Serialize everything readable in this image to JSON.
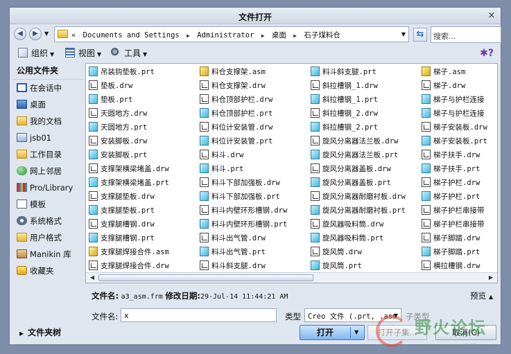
{
  "window": {
    "title": "文件打开",
    "close_glyph": "×"
  },
  "nav": {
    "back": "◀",
    "forward": "▶",
    "history_caret": "▼",
    "breadcrumbs": [
      "«",
      "Documents and Settings",
      "Administrator",
      "桌面",
      "石子煤料仓"
    ],
    "crumb_sep": "▶",
    "path_caret": "▼",
    "refresh_glyph": "⇆",
    "search_placeholder": "搜索..."
  },
  "toolbar": {
    "organize": "组织",
    "view": "视图",
    "tools": "工具",
    "caret": "▼",
    "help_glyph": "✱?"
  },
  "sidebar": {
    "heading": "公用文件夹",
    "items": [
      {
        "label": "在会话中",
        "icon": "session-icon"
      },
      {
        "label": "桌面",
        "icon": "desktop-icon"
      },
      {
        "label": "我的文档",
        "icon": "documents-folder-icon"
      },
      {
        "label": "jsb01",
        "icon": "computer-icon"
      },
      {
        "label": "工作目录",
        "icon": "working-dir-icon"
      },
      {
        "label": "网上邻居",
        "icon": "network-icon"
      },
      {
        "label": "Pro/Library",
        "icon": "library-icon"
      },
      {
        "label": "模板",
        "icon": "template-icon"
      },
      {
        "label": "系统格式",
        "icon": "system-format-icon"
      },
      {
        "label": "用户格式",
        "icon": "user-format-icon"
      },
      {
        "label": "Manikin 库",
        "icon": "manikin-icon"
      },
      {
        "label": "收藏夹",
        "icon": "favorites-icon"
      }
    ],
    "folder_tree": "文件夹树",
    "tree_caret": "▶"
  },
  "files": {
    "columns": [
      [
        {
          "name": "吊装钩垫板.prt",
          "type": "prt"
        },
        {
          "name": "垫板.drw",
          "type": "drw"
        },
        {
          "name": "垫板.prt",
          "type": "prt"
        },
        {
          "name": "天圆地方.drw",
          "type": "drw"
        },
        {
          "name": "天圆地方.prt",
          "type": "prt"
        },
        {
          "name": "安装脚板.drw",
          "type": "drw"
        },
        {
          "name": "安装脚板.prt",
          "type": "prt"
        },
        {
          "name": "支撑架横梁堵盖.drw",
          "type": "drw"
        },
        {
          "name": "支撑架横梁堵盖.prt",
          "type": "prt"
        },
        {
          "name": "支撑腿垫板.drw",
          "type": "drw"
        },
        {
          "name": "支撑腿垫板.prt",
          "type": "prt"
        },
        {
          "name": "支撑腿槽钢.drw",
          "type": "drw"
        },
        {
          "name": "支撑腿槽钢.prt",
          "type": "prt"
        },
        {
          "name": "支撑腿焊接合件.asm",
          "type": "asm"
        },
        {
          "name": "支撑腿焊接合件.drw",
          "type": "drw"
        }
      ],
      [
        {
          "name": "料仓支撑架.asm",
          "type": "asm"
        },
        {
          "name": "料仓支撑架.drw",
          "type": "drw"
        },
        {
          "name": "料仓顶部护栏.drw",
          "type": "drw"
        },
        {
          "name": "料仓顶部护栏.prt",
          "type": "prt"
        },
        {
          "name": "料位计安装管.drw",
          "type": "drw"
        },
        {
          "name": "料位计安装管.prt",
          "type": "prt"
        },
        {
          "name": "料斗.drw",
          "type": "drw"
        },
        {
          "name": "料斗.prt",
          "type": "prt"
        },
        {
          "name": "料斗下部加强板.drw",
          "type": "drw"
        },
        {
          "name": "料斗下部加强板.prt",
          "type": "prt"
        },
        {
          "name": "料斗内壁环形槽钢.drw",
          "type": "drw"
        },
        {
          "name": "料斗内壁环形槽钢.prt",
          "type": "prt"
        },
        {
          "name": "料斗出气管.drw",
          "type": "drw"
        },
        {
          "name": "料斗出气管.prt",
          "type": "prt"
        },
        {
          "name": "料斗斜支腿.drw",
          "type": "drw"
        }
      ],
      [
        {
          "name": "料斗斜支腿.prt",
          "type": "prt"
        },
        {
          "name": "斜拉槽钢_1.drw",
          "type": "drw"
        },
        {
          "name": "斜拉槽钢_1.prt",
          "type": "prt"
        },
        {
          "name": "斜拉槽钢_2.drw",
          "type": "drw"
        },
        {
          "name": "斜拉槽钢_2.prt",
          "type": "prt"
        },
        {
          "name": "旋风分离器法兰板.drw",
          "type": "drw"
        },
        {
          "name": "旋风分离器法兰板.prt",
          "type": "prt"
        },
        {
          "name": "旋风分离器盖板.drw",
          "type": "drw"
        },
        {
          "name": "旋风分离器盖板.prt",
          "type": "prt"
        },
        {
          "name": "旋风分离器耐磨衬板.drw",
          "type": "drw"
        },
        {
          "name": "旋风分离器耐磨衬板.prt",
          "type": "prt"
        },
        {
          "name": "旋风器吸料筒.drw",
          "type": "drw"
        },
        {
          "name": "旋风器吸料筒.prt",
          "type": "prt"
        },
        {
          "name": "旋风筒.drw",
          "type": "drw"
        },
        {
          "name": "旋风筒.prt",
          "type": "prt"
        }
      ],
      [
        {
          "name": "梯子.asm",
          "type": "asm"
        },
        {
          "name": "梯子.drw",
          "type": "drw"
        },
        {
          "name": "梯子与护栏连接",
          "type": "prt"
        },
        {
          "name": "梯子与护栏连接",
          "type": "prt"
        },
        {
          "name": "梯子安装板.drw",
          "type": "drw"
        },
        {
          "name": "梯子安装板.prt",
          "type": "prt"
        },
        {
          "name": "梯子扶手.drw",
          "type": "drw"
        },
        {
          "name": "梯子扶手.prt",
          "type": "prt"
        },
        {
          "name": "梯子护栏.drw",
          "type": "drw"
        },
        {
          "name": "梯子护栏.prt",
          "type": "prt"
        },
        {
          "name": "梯子护栏串接带",
          "type": "drw"
        },
        {
          "name": "梯子护栏串接带",
          "type": "drw"
        },
        {
          "name": "梯子脚踏.drw",
          "type": "drw"
        },
        {
          "name": "梯子脚踏.prt",
          "type": "prt"
        },
        {
          "name": "横拉槽钢.drw",
          "type": "drw"
        }
      ]
    ],
    "scroll_left": "◀",
    "scroll_right": "▶"
  },
  "info": {
    "filename_label": "文件名:",
    "filename_value": "a3_asm.frm",
    "modified_label": "修改日期:",
    "modified_value": "29-Jul-14 11:44:21 AM",
    "preview_label": "预览",
    "preview_caret": "▲"
  },
  "form": {
    "filename_label": "文件名:",
    "filename_value": "x",
    "type_label": "类型",
    "type_value": "Creo 文件 (.prt, .asm",
    "type_caret": "▼",
    "subtype_label": "子类型"
  },
  "buttons": {
    "open": "打开",
    "open_caret": "▼",
    "open_subset": "打开子集...",
    "cancel": "取消(C)"
  },
  "watermark": {
    "text": "野火论坛",
    "url": "www.proewildfire.cn"
  }
}
